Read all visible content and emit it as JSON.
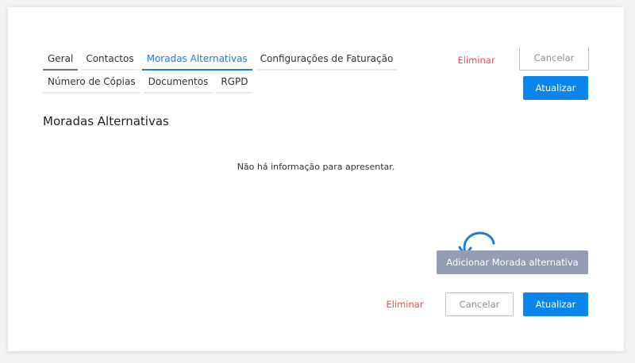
{
  "tabs_row1": [
    {
      "label": "Geral"
    },
    {
      "label": "Contactos"
    },
    {
      "label": "Moradas Alternativas"
    },
    {
      "label": "Configurações de Faturação"
    }
  ],
  "tabs_row2": [
    {
      "label": "Número de Cópias"
    },
    {
      "label": "Documentos"
    },
    {
      "label": "RGPD"
    }
  ],
  "header_actions": {
    "delete": "Eliminar",
    "cancel": "Cancelar",
    "update": "Atualizar"
  },
  "section": {
    "title": "Moradas Alternativas",
    "empty_message": "Não há informação para apresentar."
  },
  "add_button": "Adicionar Morada alternativa",
  "footer_actions": {
    "delete": "Eliminar",
    "cancel": "Cancelar",
    "update": "Atualizar"
  },
  "colors": {
    "accent": "#0b85ee",
    "danger": "#e8504f",
    "annotation_arrow": "#1a7fd6",
    "disabled_button": "#939cb1"
  },
  "icons": {
    "annotation": "curved-arrow-icon"
  }
}
